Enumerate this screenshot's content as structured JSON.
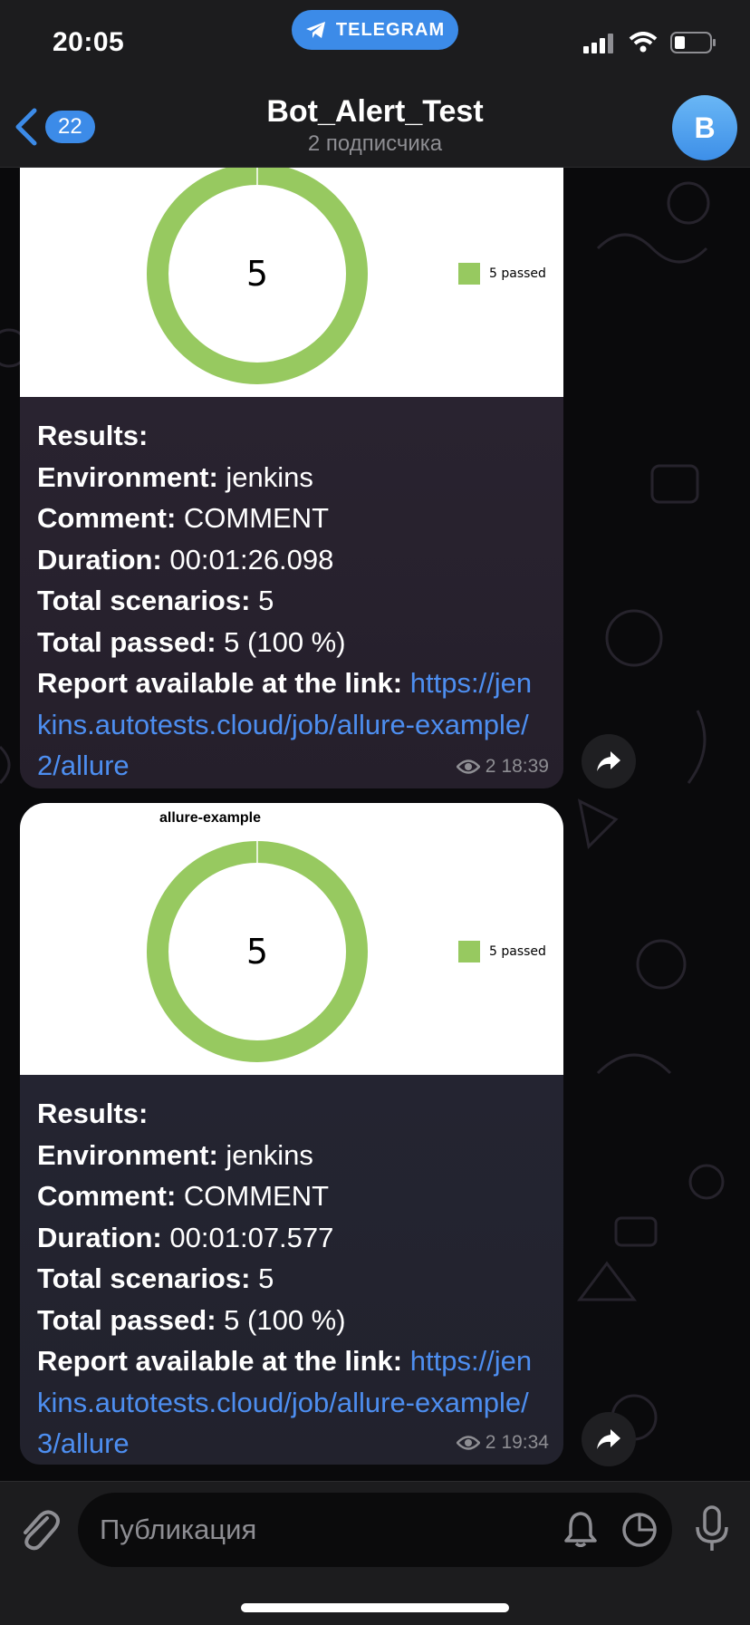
{
  "status_bar": {
    "time": "20:05",
    "app_pill": "TELEGRAM"
  },
  "header": {
    "back_badge": "22",
    "title": "Bot_Alert_Test",
    "subtitle": "2 подписчика",
    "avatar_letter": "B",
    "accent_color": "#3c8be8"
  },
  "messages": [
    {
      "chart_heading": "",
      "chart_center_value": "5",
      "legend": "5 passed",
      "lines": [
        {
          "label": "Results:",
          "value": ""
        },
        {
          "label": "Environment:",
          "value": "jenkins"
        },
        {
          "label": "Comment:",
          "value": "COMMENT"
        },
        {
          "label": "Duration:",
          "value": "00:01:26.098"
        },
        {
          "label": "Total scenarios:",
          "value": "5"
        },
        {
          "label": "Total passed:",
          "value": "5 (100 %)"
        }
      ],
      "link_label": "Report available at the link:",
      "link_url": "https://jenkins.autotests.cloud/job/allure-example/2/allure",
      "views": "2",
      "time": "18:39"
    },
    {
      "chart_heading": "allure-example",
      "chart_center_value": "5",
      "legend": "5 passed",
      "lines": [
        {
          "label": "Results:",
          "value": ""
        },
        {
          "label": "Environment:",
          "value": "jenkins"
        },
        {
          "label": "Comment:",
          "value": "COMMENT"
        },
        {
          "label": "Duration:",
          "value": "00:01:07.577"
        },
        {
          "label": "Total scenarios:",
          "value": "5"
        },
        {
          "label": "Total passed:",
          "value": "5 (100 %)"
        }
      ],
      "link_label": "Report available at the link:",
      "link_url": "https://jenkins.autotests.cloud/job/allure-example/3/allure",
      "views": "2",
      "time": "19:34"
    }
  ],
  "composer": {
    "placeholder": "Публикация"
  },
  "chart_data": [
    {
      "type": "pie",
      "categories": [
        "passed"
      ],
      "values": [
        5
      ],
      "title": "",
      "legend": [
        "5 passed"
      ],
      "colors": [
        "#97c960"
      ]
    },
    {
      "type": "pie",
      "categories": [
        "passed"
      ],
      "values": [
        5
      ],
      "title": "allure-example",
      "legend": [
        "5 passed"
      ],
      "colors": [
        "#97c960"
      ]
    }
  ]
}
